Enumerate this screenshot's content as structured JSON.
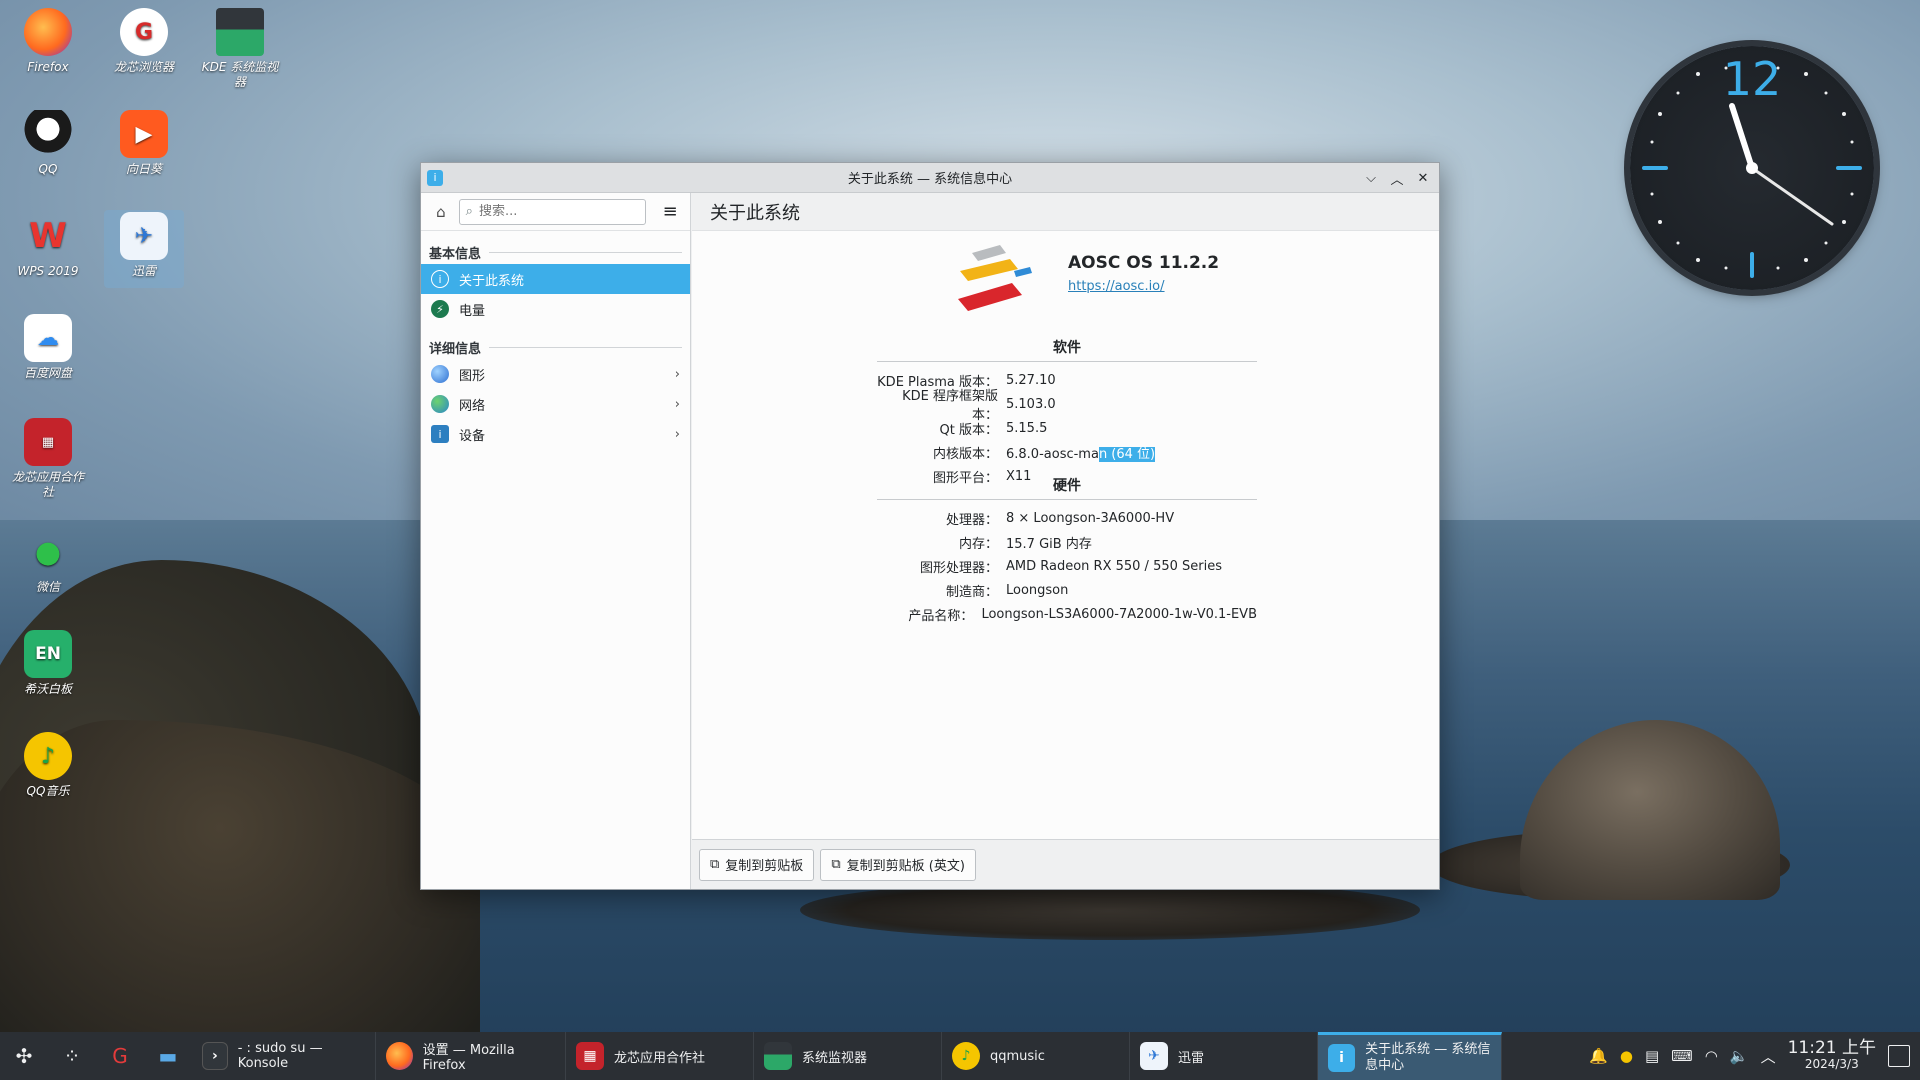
{
  "desktop": {
    "icons": [
      {
        "label": "Firefox",
        "icon": "firefox-icon"
      },
      {
        "label": "龙芯浏览器",
        "icon": "loongson-browser-icon"
      },
      {
        "label": "KDE 系统监视器",
        "icon": "system-monitor-icon"
      },
      {
        "label": "QQ",
        "icon": "qq-icon"
      },
      {
        "label": "向日葵",
        "icon": "sunlogin-icon"
      },
      {
        "label": "WPS 2019",
        "icon": "wps-icon"
      },
      {
        "label": "迅雷",
        "icon": "xunlei-icon"
      },
      {
        "label": "百度网盘",
        "icon": "baidu-netdisk-icon"
      },
      {
        "label": "龙芯应用合作社",
        "icon": "loongson-store-icon"
      },
      {
        "label": "微信",
        "icon": "wechat-icon"
      },
      {
        "label": "希沃白板",
        "icon": "seewo-icon"
      },
      {
        "label": "QQ音乐",
        "icon": "qqmusic-icon"
      }
    ],
    "clock_widget": {
      "numeral": "12"
    }
  },
  "window": {
    "title": "关于此系统 — 系统信息中心",
    "sidebar": {
      "search_placeholder": "搜索...",
      "section_basic": "基本信息",
      "section_detail": "详细信息",
      "items": [
        {
          "label": "关于此系统",
          "icon": "info-icon",
          "active": true
        },
        {
          "label": "电量",
          "icon": "battery-icon"
        },
        {
          "label": "图形",
          "icon": "graphics-icon"
        },
        {
          "label": "网络",
          "icon": "network-icon"
        },
        {
          "label": "设备",
          "icon": "devices-icon"
        }
      ]
    },
    "main": {
      "heading": "关于此系统",
      "os_name": "AOSC OS 11.2.2",
      "os_url": "https://aosc.io/",
      "software": {
        "header": "软件",
        "rows": [
          {
            "k": "KDE Plasma 版本：",
            "v": "5.27.10"
          },
          {
            "k": "KDE 程序框架版本：",
            "v": "5.103.0"
          },
          {
            "k": "Qt 版本：",
            "v": "5.15.5"
          },
          {
            "k": "内核版本：",
            "v_pre": "6.8.0-aosc-ma",
            "v_sel": "n (64 位)"
          },
          {
            "k": "图形平台：",
            "v": "X11"
          }
        ]
      },
      "hardware": {
        "header": "硬件",
        "rows": [
          {
            "k": "处理器：",
            "v": "8 × Loongson-3A6000-HV"
          },
          {
            "k": "内存：",
            "v": "15.7 GiB 内存"
          },
          {
            "k": "图形处理器：",
            "v": "AMD Radeon RX 550 / 550 Series"
          },
          {
            "k": "制造商：",
            "v": "Loongson"
          },
          {
            "k": "产品名称：",
            "v": "Loongson-LS3A6000-7A2000-1w-V0.1-EVB"
          }
        ]
      },
      "buttons": {
        "copy": "复制到剪贴板",
        "copy_en": "复制到剪贴板 (英文)"
      }
    }
  },
  "taskbar": {
    "tasks": [
      {
        "label": "- : sudo su — Konsole",
        "icon": "konsole-icon"
      },
      {
        "label": "设置 — Mozilla Firefox",
        "icon": "firefox-icon"
      },
      {
        "label": "龙芯应用合作社",
        "icon": "loongson-store-icon"
      },
      {
        "label": "系统监视器",
        "icon": "system-monitor-icon"
      },
      {
        "label": "qqmusic",
        "icon": "qqmusic-icon"
      },
      {
        "label": "迅雷",
        "icon": "xunlei-icon"
      },
      {
        "label": "关于此系统 — 系统信息中心",
        "icon": "info-icon",
        "active": true
      }
    ],
    "time": "11:21 上午",
    "date": "2024/3/3"
  },
  "colors": {
    "accent": "#3daee9",
    "taskbar": "#2b2f34",
    "link": "#2980b9"
  }
}
